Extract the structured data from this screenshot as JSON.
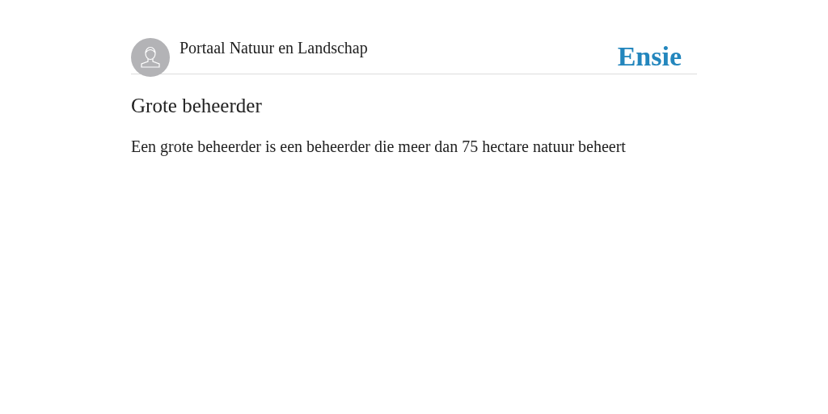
{
  "header": {
    "site_title": "Portaal Natuur en Landschap",
    "logo": "Ensie"
  },
  "entry": {
    "title": "Grote beheerder",
    "definition": "Een grote beheerder is een beheerder die meer dan 75 hectare natuur beheert"
  }
}
